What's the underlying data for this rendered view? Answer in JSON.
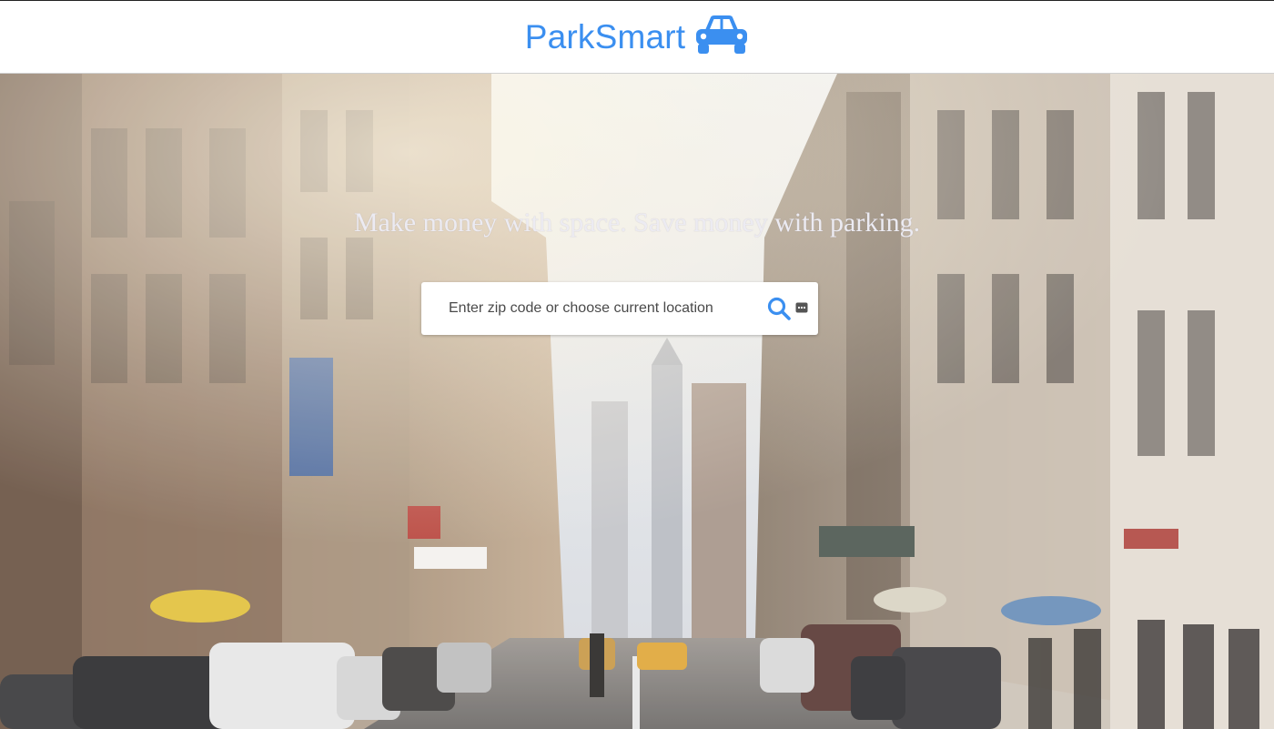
{
  "header": {
    "brand_name": "ParkSmart",
    "brand_icon": "car-icon",
    "brand_color": "#3b8ff0"
  },
  "hero": {
    "tagline": "Make money with space. Save money with parking.",
    "background": "city-street-photo"
  },
  "search": {
    "placeholder": "Enter zip code or choose current location",
    "value": "",
    "search_icon": "search-icon",
    "location_icon": "current-location-icon"
  }
}
